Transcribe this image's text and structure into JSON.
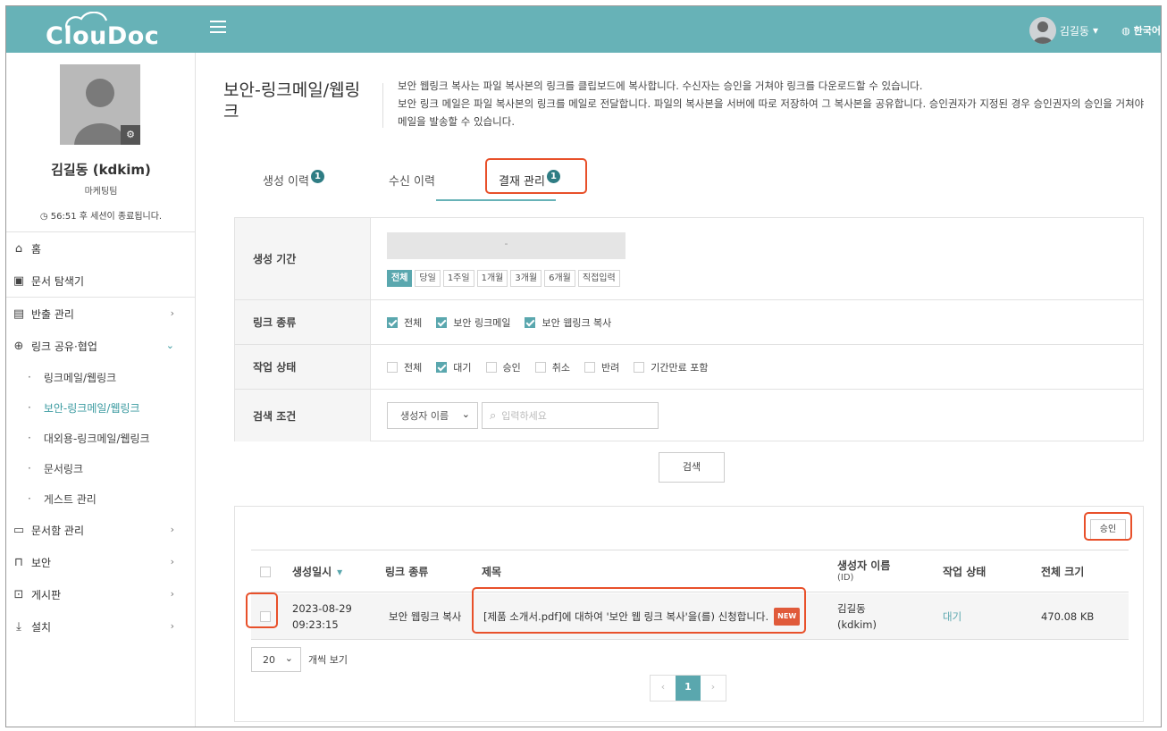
{
  "app": {
    "logo_text": "ClouDoc"
  },
  "header": {
    "user_name": "김길동",
    "user_caret": "▾",
    "language": "한국어"
  },
  "profile": {
    "name": "김길동 (kdkim)",
    "dept": "마케팅팀",
    "session_text": "56:51 후 세션이 종료됩니다."
  },
  "nav": {
    "home": "홈",
    "explorer": "문서 탐색기",
    "export": "반출 관리",
    "link_share": "링크 공유·협업",
    "sub": {
      "linkmail": "링크메일/웹링크",
      "secure_linkmail": "보안-링크메일/웹링크",
      "external_linkmail": "대외용-링크메일/웹링크",
      "doclink": "문서링크",
      "guest": "게스트 관리"
    },
    "docbox": "문서함 관리",
    "security": "보안",
    "board": "게시판",
    "settings": "설치"
  },
  "page": {
    "title": "보안-링크메일/웹링크",
    "desc1": "보안 웹링크 복사는 파일 복사본의 링크를 클립보드에 복사합니다. 수신자는 승인을 거쳐야 링크를 다운로드할 수 있습니다.",
    "desc2": "보안 링크 메일은 파일 복사본의 링크를 메일로 전달합니다. 파일의 복사본을 서버에 따로 저장하여 그 복사본을 공유합니다. 승인권자가 지정된 경우 승인권자의 승인을 거쳐야 메일을 발송할 수 있습니다."
  },
  "tabs": [
    {
      "label": "생성 이력",
      "badge": "1"
    },
    {
      "label": "수신 이력",
      "badge": ""
    },
    {
      "label": "결재 관리",
      "badge": "1"
    }
  ],
  "filters": {
    "period_label": "생성 기간",
    "date_value": "-",
    "periods": [
      "전체",
      "당일",
      "1주일",
      "1개월",
      "3개월",
      "6개월",
      "직접입력"
    ],
    "link_type_label": "링크 종류",
    "link_types": [
      "전체",
      "보안 링크메일",
      "보안 웹링크 복사"
    ],
    "status_label": "작업 상태",
    "statuses": [
      "전체",
      "대기",
      "승인",
      "취소",
      "반려",
      "기간만료 포함"
    ],
    "search_label": "검색 조건",
    "search_field": "생성자 이름",
    "search_placeholder": "입력하세요",
    "search_button": "검색"
  },
  "results": {
    "approve_button": "승인",
    "columns": {
      "created": "생성일시",
      "sort_icon": "▾",
      "link_type": "링크 종류",
      "title": "제목",
      "creator": "생성자 이름",
      "creator_id": "(ID)",
      "status": "작업 상태",
      "size": "전체 크기"
    },
    "rows": [
      {
        "date": "2023-08-29",
        "time": "09:23:15",
        "link_type": "보안 웹링크 복사",
        "title": "[제품 소개서.pdf]에 대하여 '보안 웹 링크 복사'을(를) 신청합니다.",
        "new_tag": "NEW",
        "creator_name": "김길동",
        "creator_id": "(kdkim)",
        "status": "대기",
        "size": "470.08 KB"
      }
    ],
    "page_size": "20",
    "page_size_suffix": "개씩 보기",
    "pager": {
      "prev": "‹",
      "current": "1",
      "next": "›"
    }
  },
  "colors": {
    "header_bg": "#67b2b7",
    "accent": "#5aa7ae",
    "highlight": "#e8502a"
  }
}
